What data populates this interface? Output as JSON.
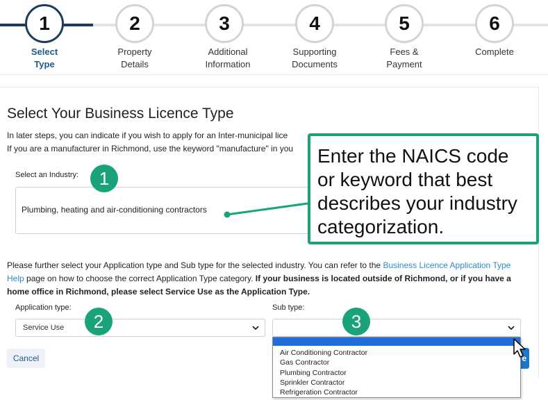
{
  "steps": [
    {
      "number": "1",
      "label": "Select Type",
      "active": true
    },
    {
      "number": "2",
      "label": "Property Details"
    },
    {
      "number": "3",
      "label": "Additional Information"
    },
    {
      "number": "4",
      "label": "Supporting Documents"
    },
    {
      "number": "5",
      "label": "Fees & Payment"
    },
    {
      "number": "6",
      "label": "Complete"
    }
  ],
  "page": {
    "title": "Select Your Business Licence Type",
    "intro_line1": "In later steps, you can indicate if you wish to apply for an Inter-municipal lice",
    "intro_line2": "If you are a manufacturer in Richmond, use the keyword \"manufacture\" in you"
  },
  "industry": {
    "label": "Select an Industry:",
    "value": "Plumbing, heating and air-conditioning contractors"
  },
  "further": {
    "text_before_link": "Please further select your Application type and Sub type for the selected industry. You can refer to the ",
    "link": "Business Licence Application Type Help",
    "text_after_link": " page on how to choose the correct Application Type category. ",
    "bold": "If your business is located outside of Richmond, or if you have a home office in Richmond, please select Service Use as the Application Type."
  },
  "application_type": {
    "label": "Application type:",
    "value": "Service Use"
  },
  "sub_type": {
    "label": "Sub type:",
    "value": "",
    "options": [
      "Air Conditioning Contractor",
      "Gas Contractor",
      "Plumbing Contractor",
      "Sprinkler Contractor",
      "Refrigeration Contractor"
    ]
  },
  "buttons": {
    "cancel": "Cancel",
    "next_fragment": "e"
  },
  "annotations": {
    "badge1": "1",
    "badge2": "2",
    "badge3": "3",
    "callout": "Enter the NAICS code or keyword that best describes your industry categorization."
  },
  "colors": {
    "accent": "#1aa37a",
    "step_active": "#1e3a5f",
    "link": "#2a8ac8",
    "highlight": "#1e6fd9"
  }
}
